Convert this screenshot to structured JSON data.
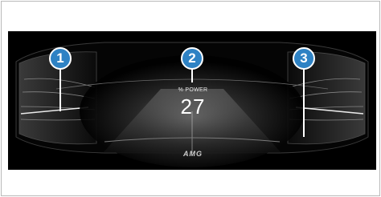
{
  "display": {
    "power_label": "% POWER",
    "power_value": "27",
    "brand_logo": "AMG"
  },
  "callouts": [
    {
      "number": "1"
    },
    {
      "number": "2"
    },
    {
      "number": "3"
    }
  ],
  "colors": {
    "marker_blue": "#2e82c4",
    "screen_background": "#000000"
  }
}
